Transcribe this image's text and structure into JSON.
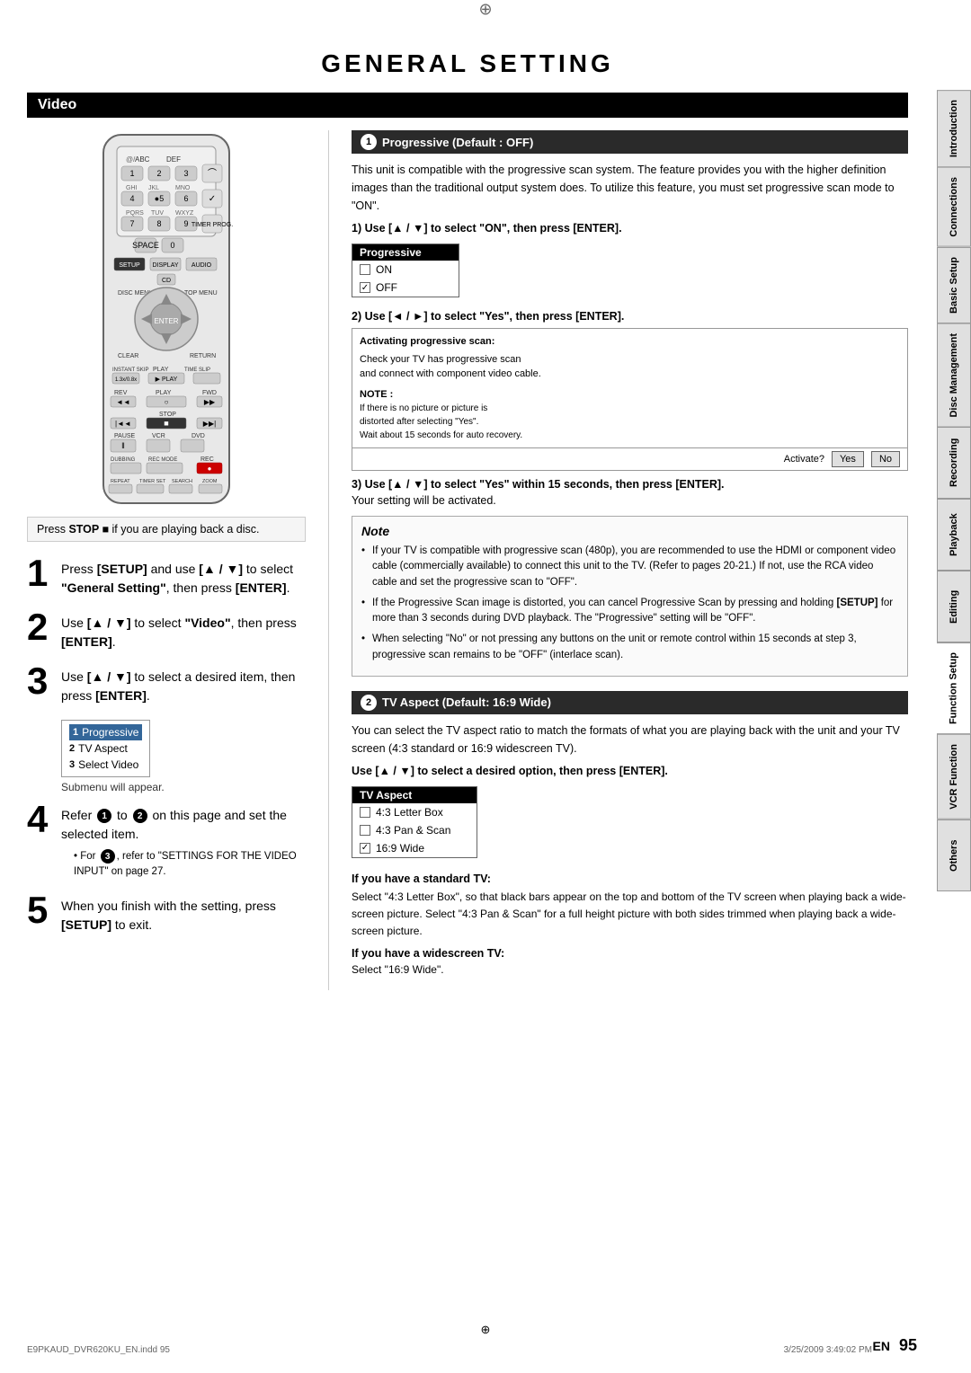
{
  "page": {
    "title": "GENERAL SETTING",
    "section": "Video",
    "page_number": "95",
    "en_label": "EN",
    "footer_file": "E9PKAUD_DVR620KU_EN.indd 95",
    "footer_date": "3/25/2009  3:49:02 PM"
  },
  "sidebar": {
    "tabs": [
      {
        "label": "Introduction",
        "active": false
      },
      {
        "label": "Connections",
        "active": false
      },
      {
        "label": "Basic Setup",
        "active": false
      },
      {
        "label": "Disc Management",
        "active": false
      },
      {
        "label": "Recording",
        "active": false
      },
      {
        "label": "Playback",
        "active": false
      },
      {
        "label": "Editing",
        "active": false
      },
      {
        "label": "Function Setup",
        "active": true
      },
      {
        "label": "VCR Function",
        "active": false
      },
      {
        "label": "Others",
        "active": false
      }
    ]
  },
  "left_column": {
    "press_stop_text": "Press STOP ■ if you are playing back a disc.",
    "step1": {
      "number": "1",
      "text": "Press [SETUP] and use [▲ / ▼] to select \"General Setting\", then press [ENTER]."
    },
    "step2": {
      "number": "2",
      "text": "Use [▲ / ▼] to select \"Video\", then press [ENTER]."
    },
    "step3": {
      "number": "3",
      "text": "Use [▲ / ▼] to select a desired item, then press [ENTER]."
    },
    "submenu_items": [
      {
        "num": "1",
        "label": "Progressive",
        "highlighted": true
      },
      {
        "num": "2",
        "label": "TV Aspect",
        "highlighted": false
      },
      {
        "num": "3",
        "label": "Select Video",
        "highlighted": false
      }
    ],
    "submenu_appear": "Submenu will appear.",
    "step4": {
      "number": "4",
      "text_prefix": "Refer",
      "num1": "1",
      "text_middle": "to",
      "num2": "2",
      "text_suffix": "on this page and set the selected item.",
      "note": "• For",
      "note_num": "3",
      "note_suffix": ", refer to \"SETTINGS FOR THE VIDEO INPUT\" on page 27."
    },
    "step5": {
      "number": "5",
      "text": "When you finish with the setting, press [SETUP] to exit."
    }
  },
  "right_column": {
    "section1": {
      "num": "1",
      "title": "Progressive (Default : OFF)",
      "intro": "This unit is compatible with the progressive scan system. The feature provides you with the higher definition images than the traditional output system does. To utilize this feature, you must set progressive scan mode to \"ON\".",
      "step1_instruction": "1) Use [▲ / ▼] to select \"ON\", then press [ENTER].",
      "progressive_box": {
        "header": "Progressive",
        "items": [
          {
            "label": "ON",
            "checked": false
          },
          {
            "label": "OFF",
            "checked": true
          }
        ]
      },
      "step2_instruction": "2) Use [◄ / ►] to select \"Yes\", then press [ENTER].",
      "activation_box": {
        "main_text": "Activating progressive scan:\nCheck your TV has progressive scan\nand connect with component video cable.",
        "note_label": "NOTE :",
        "note_text": "If there is no picture or picture is\ndistorted after selecting \"Yes\",\nWait about 15 seconds for auto recovery.",
        "activate_label": "Activate?",
        "yes_btn": "Yes",
        "no_btn": "No"
      },
      "step3_instruction": "3) Use [▲ / ▼] to select \"Yes\" within 15 seconds, then press [ENTER].",
      "step3_note": "Your setting will be activated.",
      "note_box": {
        "title": "Note",
        "items": [
          "If your TV is compatible with progressive scan (480p), you are recommended to use the HDMI or component video cable (commercially available) to connect this unit to the TV. (Refer to pages 20-21.) If not, use the RCA video cable and set the progressive scan to \"OFF\".",
          "If the Progressive Scan image is distorted, you can cancel Progressive Scan by pressing and holding [SETUP] for more than 3 seconds during DVD playback. The \"Progressive\" setting will be \"OFF\".",
          "When selecting \"No\" or not pressing any buttons on the unit or remote control within 15 seconds at step 3, progressive scan remains to be \"OFF\" (interlace scan)."
        ]
      }
    },
    "section2": {
      "num": "2",
      "title": "TV Aspect (Default: 16:9 Wide)",
      "intro": "You can select the TV aspect ratio to match the formats of what you are playing back with the unit and your TV screen (4:3 standard or 16:9 widescreen TV).",
      "instruction": "Use [▲ / ▼] to select a desired option, then press [ENTER].",
      "tv_aspect_box": {
        "header": "TV Aspect",
        "items": [
          {
            "label": "4:3 Letter Box",
            "checked": false
          },
          {
            "label": "4:3 Pan & Scan",
            "checked": false
          },
          {
            "label": "16:9 Wide",
            "checked": true
          }
        ]
      },
      "standard_tv": {
        "title": "If you have a standard TV:",
        "text": "Select \"4:3 Letter Box\", so that black bars appear on the top and bottom of the TV screen when playing back a wide-screen picture. Select \"4:3 Pan & Scan\" for a full height picture with both sides trimmed when playing back a wide-screen picture."
      },
      "widescreen_tv": {
        "title": "If you have a widescreen TV:",
        "text": "Select \"16:9 Wide\"."
      }
    }
  }
}
